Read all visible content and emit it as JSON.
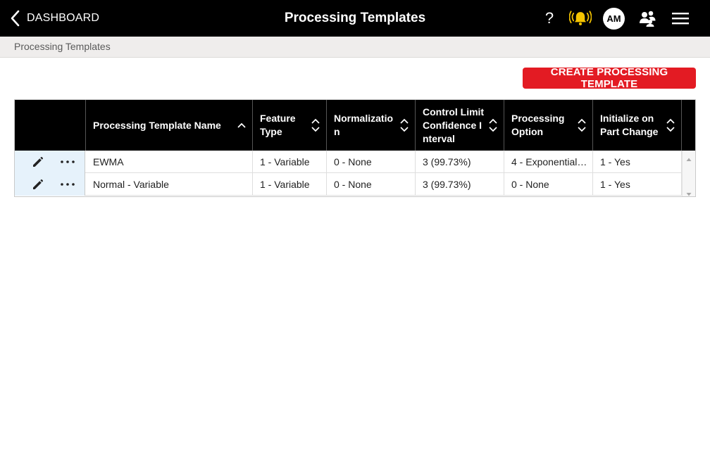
{
  "header": {
    "back_label": "DASHBOARD",
    "title": "Processing Templates",
    "help_glyph": "?",
    "avatar_initials": "AM",
    "icons": [
      "chevron-left-icon",
      "help-icon",
      "alarm-bell-icon",
      "users-icon",
      "hamburger-menu-icon"
    ],
    "alert_color": "#f5c400"
  },
  "breadcrumb": {
    "label": "Processing Templates"
  },
  "toolbar": {
    "create_label": "CREATE PROCESSING TEMPLATE",
    "create_color": "#e31b23"
  },
  "table": {
    "columns": [
      "Processing Template Name",
      "Feature Type",
      "Normalization",
      "Control Limit Confidence Interval",
      "Processing Option",
      "Initialize on Part Change"
    ],
    "rows": [
      {
        "name": "EWMA",
        "feature_type": "1 - Variable",
        "normalization": "0 - None",
        "confidence": "3 (99.73%)",
        "processing_option": "4 - Exponential…",
        "initialize": "1 - Yes"
      },
      {
        "name": "Normal - Variable",
        "feature_type": "1 - Variable",
        "normalization": "0 - None",
        "confidence": "3 (99.73%)",
        "processing_option": "0 - None",
        "initialize": "1 - Yes"
      }
    ]
  }
}
